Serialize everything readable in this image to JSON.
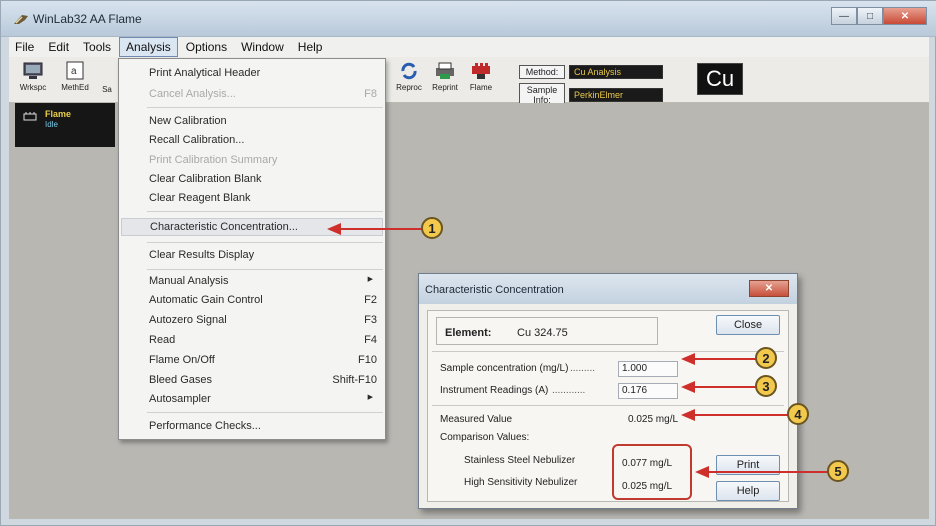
{
  "window": {
    "title": "WinLab32 AA Flame",
    "minimize": "—",
    "maximize": "□",
    "close": "✕"
  },
  "menubar": [
    "File",
    "Edit",
    "Tools",
    "Analysis",
    "Options",
    "Window",
    "Help"
  ],
  "toolbar": {
    "buttons": [
      "Wrkspc",
      "MethEd",
      "Sa",
      "Reproc",
      "Reprint",
      "Flame"
    ],
    "method_label": "Method:",
    "method_value": "Cu Analysis",
    "sample_label": "Sample Info:",
    "sample_value": "PerkinElmer",
    "element_badge": "Cu"
  },
  "status": {
    "line1": "Flame",
    "line2": "Idle"
  },
  "analysis_menu": [
    {
      "label": "Print Analytical Header",
      "shortcut": "",
      "disabled": false
    },
    {
      "label": "Cancel Analysis...",
      "shortcut": "F8",
      "disabled": true
    },
    {
      "label": "New Calibration",
      "shortcut": "",
      "disabled": false
    },
    {
      "label": "Recall Calibration...",
      "shortcut": "",
      "disabled": false
    },
    {
      "label": "Print Calibration Summary",
      "shortcut": "",
      "disabled": true
    },
    {
      "label": "Clear Calibration Blank",
      "shortcut": "",
      "disabled": false
    },
    {
      "label": "Clear Reagent Blank",
      "shortcut": "",
      "disabled": false
    },
    {
      "label": "Characteristic Concentration...",
      "shortcut": "",
      "disabled": false
    },
    {
      "label": "Clear Results Display",
      "shortcut": "",
      "disabled": false
    },
    {
      "label": "Manual Analysis",
      "shortcut": "",
      "disabled": false
    },
    {
      "label": "Automatic Gain Control",
      "shortcut": "F2",
      "disabled": false
    },
    {
      "label": "Autozero Signal",
      "shortcut": "F3",
      "disabled": false
    },
    {
      "label": "Read",
      "shortcut": "F4",
      "disabled": false
    },
    {
      "label": "Flame On/Off",
      "shortcut": "F10",
      "disabled": false
    },
    {
      "label": "Bleed Gases",
      "shortcut": "Shift-F10",
      "disabled": false
    },
    {
      "label": "Autosampler",
      "shortcut": "",
      "disabled": false
    },
    {
      "label": "Performance Checks...",
      "shortcut": "",
      "disabled": false
    }
  ],
  "dialog": {
    "title": "Characteristic Concentration",
    "close_x": "✕",
    "element_label": "Element:",
    "element_value": "Cu 324.75",
    "close_button": "Close",
    "sample_conc_label": "Sample concentration (mg/L)",
    "sample_conc_value": "1.000",
    "instrument_label": "Instrument Readings (A)",
    "instrument_value": "0.176",
    "measured_label": "Measured Value",
    "measured_value": "0.025 mg/L",
    "comparison_label": "Comparison Values:",
    "stainless_label": "Stainless Steel Nebulizer",
    "stainless_value": "0.077 mg/L",
    "highsens_label": "High Sensitivity Nebulizer",
    "highsens_value": "0.025 mg/L",
    "print_button": "Print",
    "help_button": "Help"
  },
  "callouts": [
    "1",
    "2",
    "3",
    "4",
    "5"
  ],
  "colors": {
    "annotation_red": "#cf2f2a",
    "callout_yellow": "#f2c94c"
  }
}
